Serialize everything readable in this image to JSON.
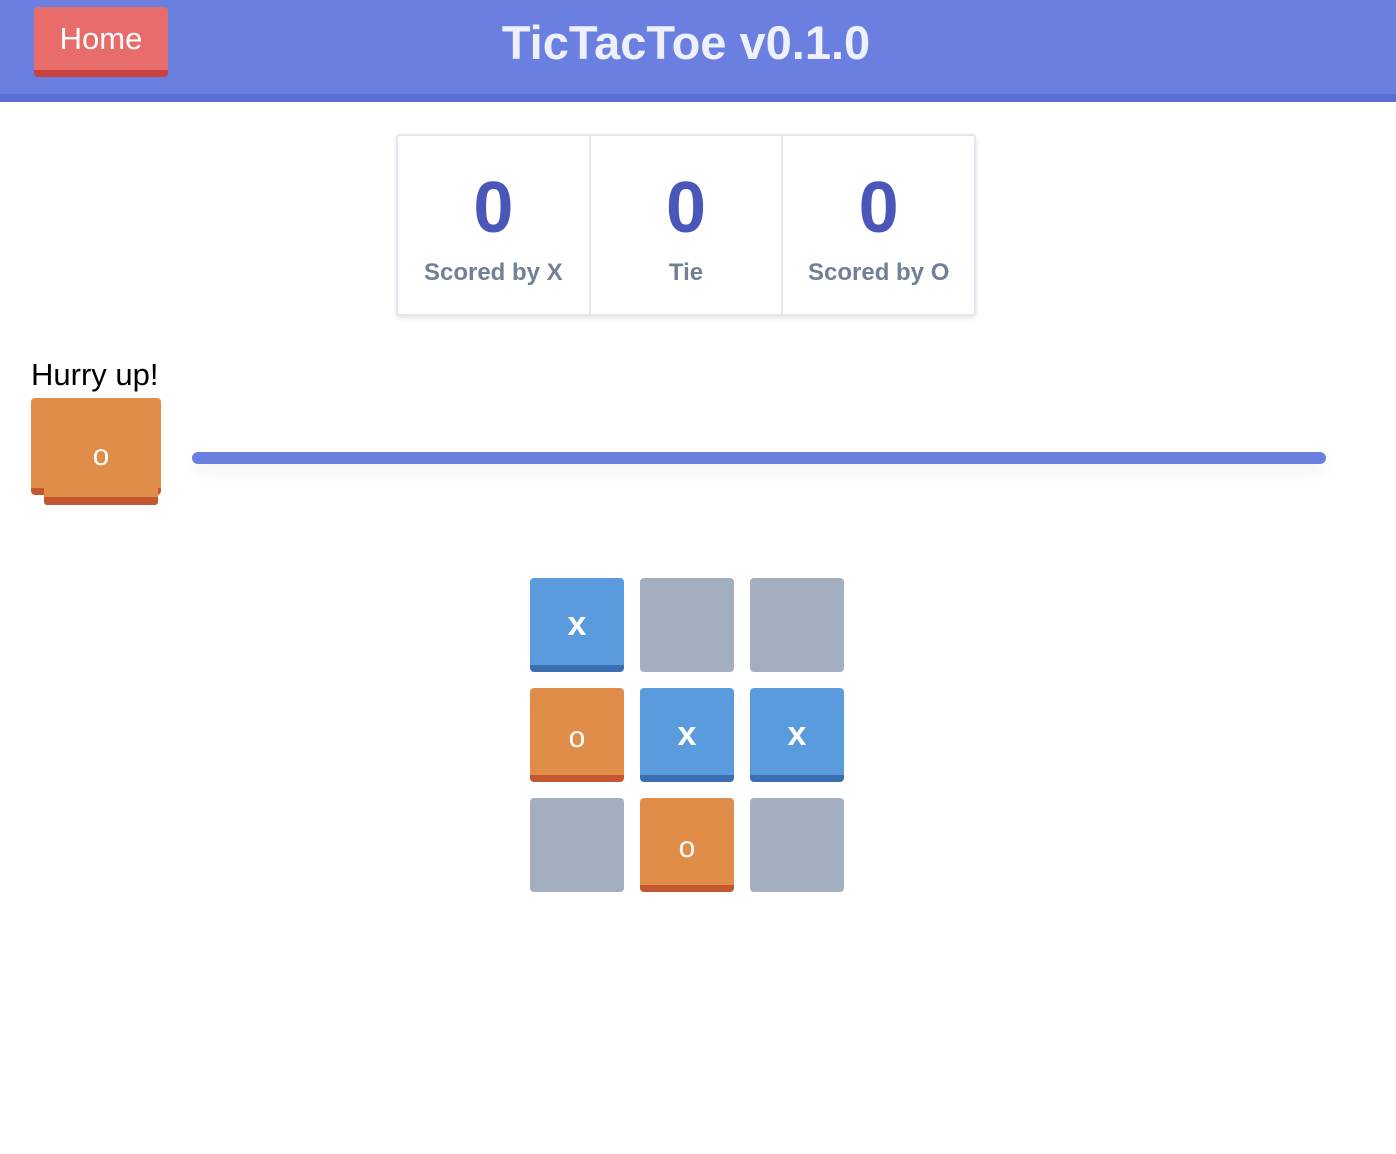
{
  "header": {
    "home_label": "Home",
    "title": "TicTacToe v0.1.0"
  },
  "scores": [
    {
      "value": "0",
      "label": "Scored by X"
    },
    {
      "value": "0",
      "label": "Tie"
    },
    {
      "value": "0",
      "label": "Scored by O"
    }
  ],
  "status": {
    "message": "Hurry up!",
    "current_player": "o",
    "timer_remaining_percent": 100
  },
  "board": {
    "cells": [
      "x",
      "",
      "",
      "o",
      "x",
      "x",
      "",
      "o",
      ""
    ]
  },
  "colors": {
    "header": "#6a7fe0",
    "home_button": "#e86c6a",
    "x_tile": "#5a9bde",
    "o_tile": "#e08d4a",
    "empty_tile": "#a3afc0",
    "score_number": "#4a56b8"
  }
}
